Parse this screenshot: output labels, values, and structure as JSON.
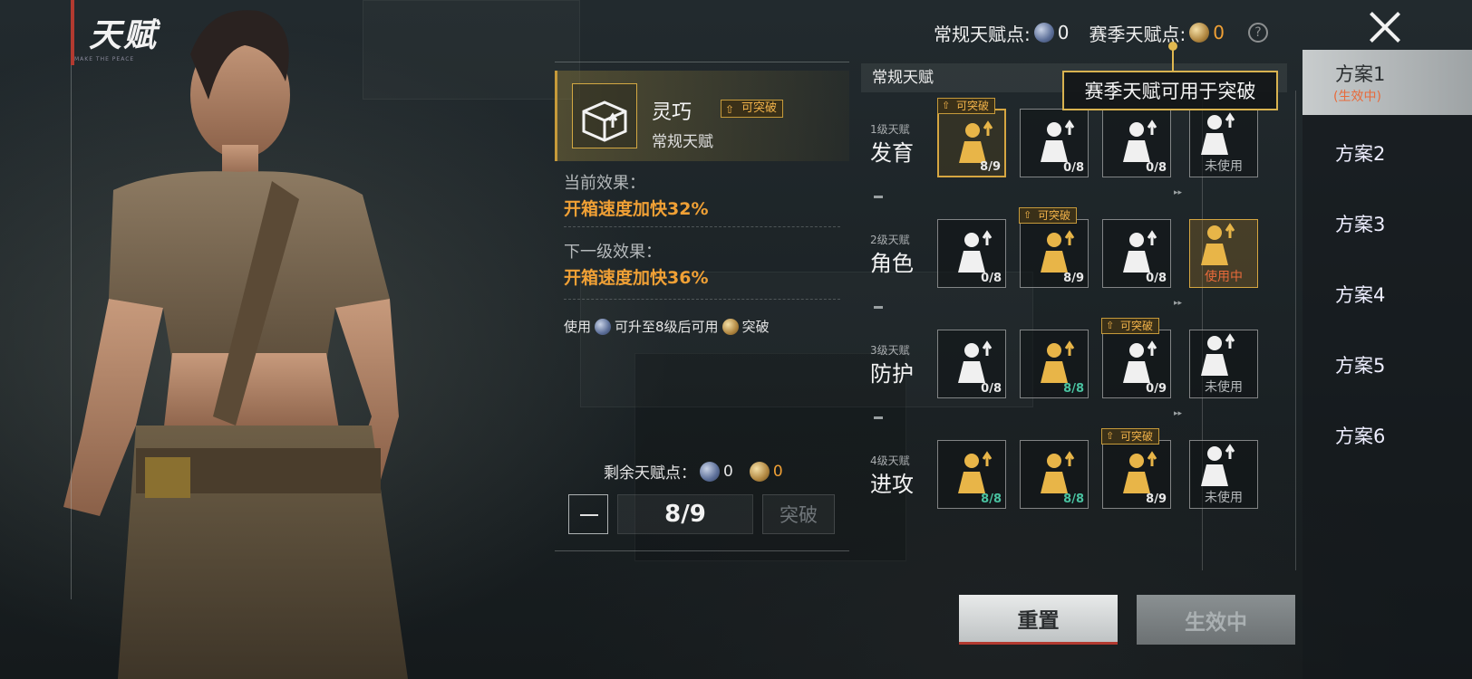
{
  "title": "天赋",
  "title_sub": "MAKE THE PEACE",
  "points": {
    "regular_label": "常规天赋点:",
    "regular_value": "0",
    "season_label": "赛季天赋点:",
    "season_value": "0"
  },
  "tooltip": "赛季天赋可用于突破",
  "plans": [
    {
      "label": "方案1",
      "sub": "(生效中)"
    },
    {
      "label": "方案2",
      "sub": ""
    },
    {
      "label": "方案3",
      "sub": ""
    },
    {
      "label": "方案4",
      "sub": ""
    },
    {
      "label": "方案5",
      "sub": ""
    },
    {
      "label": "方案6",
      "sub": ""
    }
  ],
  "detail": {
    "name": "灵巧",
    "tag": "可突破",
    "type": "常规天赋",
    "current_label": "当前效果：",
    "current_value": "开箱速度加快32%",
    "next_label": "下一级效果：",
    "next_value": "开箱速度加快36%",
    "usage_prefix": "使用",
    "usage_mid": "可升至8级后可用",
    "usage_suffix": "突破",
    "remain_label": "剩余天赋点：",
    "remain_regular": "0",
    "remain_season": "0",
    "level": "8/9",
    "break_label": "突破"
  },
  "grid": {
    "header": "常规天赋",
    "rows": [
      {
        "lv": "1级天赋",
        "name": "发育",
        "slots": [
          {
            "icon": "supply-box-icon",
            "count": "8/9",
            "max": false,
            "tag": "可突破",
            "selected": true
          },
          {
            "icon": "loot-crate-icon",
            "count": "0/8",
            "max": false,
            "tag": "",
            "selected": false
          },
          {
            "icon": "runner-radar-icon",
            "count": "0/8",
            "max": false,
            "tag": "",
            "selected": false
          }
        ],
        "side": {
          "icon": "broken-lock-icon",
          "status": "未使用",
          "using": false
        }
      },
      {
        "lv": "2级天赋",
        "name": "角色",
        "slots": [
          {
            "icon": "stealth-soldier-icon",
            "count": "0/8",
            "max": false,
            "tag": "",
            "selected": false
          },
          {
            "icon": "sprint-icon",
            "count": "8/9",
            "max": false,
            "tag": "可突破",
            "selected": false
          },
          {
            "icon": "backpack-upgrade-icon",
            "count": "0/8",
            "max": false,
            "tag": "",
            "selected": false
          }
        ],
        "side": {
          "icon": "muscle-icon",
          "status": "使用中",
          "using": true
        }
      },
      {
        "lv": "3级天赋",
        "name": "防护",
        "slots": [
          {
            "icon": "armor-body-icon",
            "count": "0/8",
            "max": false,
            "tag": "",
            "selected": false
          },
          {
            "icon": "vest-icon",
            "count": "8/8",
            "max": true,
            "tag": "",
            "selected": false
          },
          {
            "icon": "glove-icon",
            "count": "0/9",
            "max": false,
            "tag": "可突破",
            "selected": false
          }
        ],
        "side": {
          "icon": "airdrop-gun-icon",
          "status": "未使用",
          "using": false
        }
      },
      {
        "lv": "4级天赋",
        "name": "进攻",
        "slots": [
          {
            "icon": "rifle-icon",
            "count": "8/8",
            "max": true,
            "tag": "",
            "selected": false
          },
          {
            "icon": "ammo-drop-icon",
            "count": "8/8",
            "max": true,
            "tag": "",
            "selected": false
          },
          {
            "icon": "shield-break-icon",
            "count": "8/9",
            "max": false,
            "tag": "可突破",
            "selected": false
          }
        ],
        "side": {
          "icon": "bullet-icon",
          "status": "未使用",
          "using": false
        }
      }
    ]
  },
  "buttons": {
    "reset": "重置",
    "apply": "生效中"
  },
  "colors": {
    "accent": "#f0a035",
    "gold": "#d6a641",
    "red": "#b23a30",
    "max": "#49c2a0"
  }
}
